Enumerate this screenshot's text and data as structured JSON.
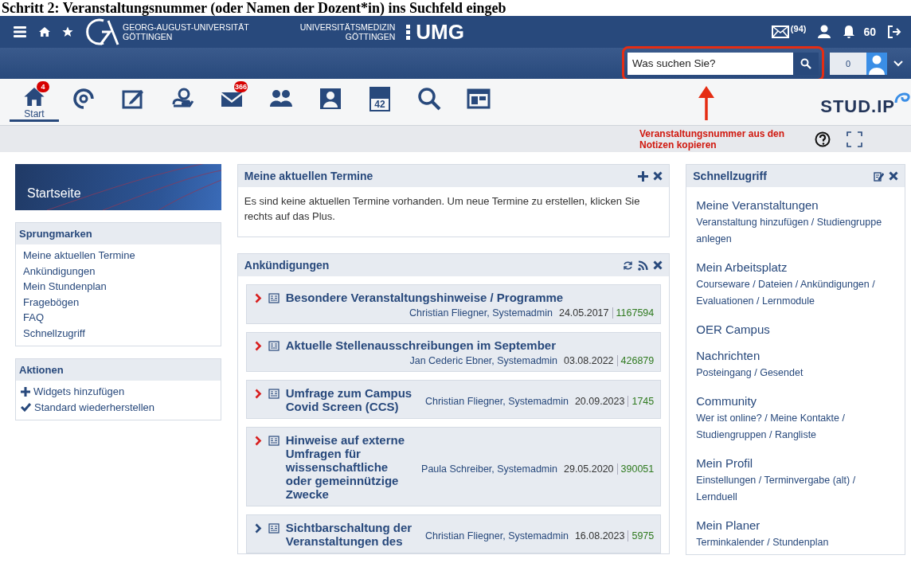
{
  "instruction_heading": "Schritt 2: Veranstaltungsnummer (oder Namen der Dozent*in) ins Suchfeld eingeb",
  "topbar": {
    "uni_line_1": "GEORG-AUGUST-UNIVERSITÄT",
    "uni_line_2": "GÖTTINGEN",
    "umg_line_1": "UNIVERSITÄTSMEDIZIN",
    "umg_line_2": "GÖTTINGEN",
    "umg_logo": "UMG",
    "mail_count": "(94)",
    "notification_count": "60"
  },
  "search": {
    "placeholder": "Was suchen Sie?"
  },
  "user_counter": "0",
  "nav": [
    {
      "kind": "home",
      "label": "Start",
      "badge": "4",
      "selected": true
    },
    {
      "kind": "activity",
      "selected": false
    },
    {
      "kind": "edit",
      "selected": false
    },
    {
      "kind": "hand",
      "selected": false
    },
    {
      "kind": "mail",
      "badge": "366",
      "selected": false
    },
    {
      "kind": "people",
      "selected": false
    },
    {
      "kind": "profile",
      "selected": false
    },
    {
      "kind": "calendar",
      "day": "42",
      "selected": false
    },
    {
      "kind": "search",
      "selected": false
    },
    {
      "kind": "tiles",
      "selected": false
    }
  ],
  "brand": "STUD.IP",
  "annotation": "Veranstaltungsnummer aus den Notizen kopieren",
  "sidebar": {
    "title": "Startseite",
    "sections": [
      {
        "title": "Sprungmarken",
        "items": [
          {
            "label": "Meine aktuellen Termine"
          },
          {
            "label": "Ankündigungen"
          },
          {
            "label": "Mein Stundenplan"
          },
          {
            "label": "Fragebögen"
          },
          {
            "label": "FAQ"
          },
          {
            "label": "Schnellzugriff"
          }
        ]
      },
      {
        "title": "Aktionen",
        "items": [
          {
            "kind": "plus",
            "label": "Widgets hinzufügen"
          },
          {
            "kind": "check",
            "label": "Standard wiederherstellen"
          }
        ]
      }
    ]
  },
  "termine": {
    "title": "Meine aktuellen Termine",
    "text": "Es sind keine aktuellen Termine vorhanden. Um neue Termine zu erstellen, klicken Sie rechts auf das Plus."
  },
  "announcements": {
    "title": "Ankündigungen",
    "items": [
      {
        "title": "Besondere Veranstaltungshinweise / Programme",
        "author": "Christian Fliegner, Systemadmin",
        "date": "24.05.2017",
        "views": "1167594",
        "kind": "stacked",
        "new": true
      },
      {
        "title": "Aktuelle Stellenausschreibungen im September",
        "author": "Jan Cederic Ebner, Systemadmin",
        "date": "03.08.2022",
        "views": "426879",
        "kind": "stacked",
        "new": true
      },
      {
        "title": "Umfrage zum Campus Covid Screen (CCS)",
        "author": "Christian Fliegner, Systemadmin",
        "date": "20.09.2023",
        "views": "1745",
        "kind": "inline",
        "new": true
      },
      {
        "title": "Hinweise auf externe Umfragen für wissenschaftliche oder gemeinnützige Zwecke",
        "author": "Paula Schreiber, Systemadmin",
        "date": "29.05.2020",
        "views": "390051",
        "kind": "inline",
        "new": true
      },
      {
        "title": "Sichtbarschaltung der Veranstaltungen des",
        "author": "Christian Fliegner, Systemadmin",
        "date": "16.08.2023",
        "views": "5975",
        "kind": "inline",
        "new": false
      }
    ]
  },
  "quick_access": {
    "title": "Schnellzugriff",
    "groups": [
      {
        "title": "Meine Veranstaltungen",
        "links": "Veranstaltung hinzufügen / Studiengruppe anlegen"
      },
      {
        "title": "Mein Arbeitsplatz",
        "links": "Courseware / Dateien / Ankündigungen / Evaluationen / Lernmodule"
      },
      {
        "title": "OER Campus"
      },
      {
        "title": "Nachrichten",
        "links": "Posteingang / Gesendet"
      },
      {
        "title": "Community",
        "links": "Wer ist online? / Meine Kontakte / Studiengruppen / Rangliste"
      },
      {
        "title": "Mein Profil",
        "links": "Einstellungen / Terminvergabe (alt) / Lernduell"
      },
      {
        "title": "Mein Planer",
        "links": "Terminkalender / Stundenplan"
      }
    ]
  }
}
